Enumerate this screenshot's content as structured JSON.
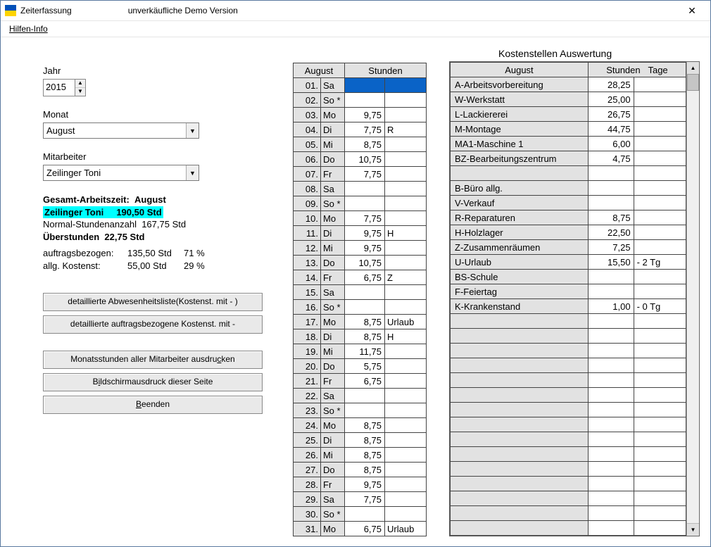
{
  "window": {
    "title": "Zeiterfassung",
    "subtitle": "unverkäufliche Demo Version"
  },
  "menu": {
    "hilfen": "Hilfen-Info"
  },
  "left": {
    "year_label": "Jahr",
    "year_value": "2015",
    "month_label": "Monat",
    "month_value": "August",
    "employee_label": "Mitarbeiter",
    "employee_value": "Zeilinger Toni",
    "summary": {
      "header_prefix": "Gesamt-Arbeitszeit:",
      "header_month": "August",
      "hi_name": "Zeilinger Toni",
      "hi_hours": "190,50 Std",
      "normal_label": "Normal-Stundenanzahl",
      "normal_value": "167,75 Std",
      "over_label": "Überstunden",
      "over_value": "22,75 Std",
      "auftrag_label": "auftragsbezogen:",
      "auftrag_value": "135,50 Std",
      "auftrag_pct": "71 %",
      "allg_label": "allg. Kostenst:",
      "allg_value": "55,00 Std",
      "allg_pct": "29 %"
    },
    "buttons": {
      "b1": "detaillierte Abwesenheitsliste(Kostenst. mit - )",
      "b2": "detaillierte auftragsbezogene Kostenst. mit -",
      "b3_pre": "Monatsstunden aller Mitarbeiter ausdru",
      "b3_u": "c",
      "b3_post": "ken",
      "b4_pre": "B",
      "b4_u": "i",
      "b4_post": "ldschirmausdruck dieser Seite",
      "b5_u": "B",
      "b5_post": "eenden"
    }
  },
  "mid": {
    "h1": "August",
    "h2": "Stunden",
    "rows": [
      {
        "d": "01.",
        "wd": "Sa",
        "h": "",
        "n": "",
        "sel": true
      },
      {
        "d": "02.",
        "wd": "So *",
        "h": "",
        "n": ""
      },
      {
        "d": "03.",
        "wd": "Mo",
        "h": "9,75",
        "n": ""
      },
      {
        "d": "04.",
        "wd": "Di",
        "h": "7,75",
        "n": "R"
      },
      {
        "d": "05.",
        "wd": "Mi",
        "h": "8,75",
        "n": ""
      },
      {
        "d": "06.",
        "wd": "Do",
        "h": "10,75",
        "n": ""
      },
      {
        "d": "07.",
        "wd": "Fr",
        "h": "7,75",
        "n": ""
      },
      {
        "d": "08.",
        "wd": "Sa",
        "h": "",
        "n": ""
      },
      {
        "d": "09.",
        "wd": "So *",
        "h": "",
        "n": ""
      },
      {
        "d": "10.",
        "wd": "Mo",
        "h": "7,75",
        "n": ""
      },
      {
        "d": "11.",
        "wd": "Di",
        "h": "9,75",
        "n": "H"
      },
      {
        "d": "12.",
        "wd": "Mi",
        "h": "9,75",
        "n": ""
      },
      {
        "d": "13.",
        "wd": "Do",
        "h": "10,75",
        "n": ""
      },
      {
        "d": "14.",
        "wd": "Fr",
        "h": "6,75",
        "n": "Z"
      },
      {
        "d": "15.",
        "wd": "Sa",
        "h": "",
        "n": ""
      },
      {
        "d": "16.",
        "wd": "So *",
        "h": "",
        "n": ""
      },
      {
        "d": "17.",
        "wd": "Mo",
        "h": "8,75",
        "n": "Urlaub"
      },
      {
        "d": "18.",
        "wd": "Di",
        "h": "8,75",
        "n": "H"
      },
      {
        "d": "19.",
        "wd": "Mi",
        "h": "11,75",
        "n": ""
      },
      {
        "d": "20.",
        "wd": "Do",
        "h": "5,75",
        "n": ""
      },
      {
        "d": "21.",
        "wd": "Fr",
        "h": "6,75",
        "n": ""
      },
      {
        "d": "22.",
        "wd": "Sa",
        "h": "",
        "n": ""
      },
      {
        "d": "23.",
        "wd": "So *",
        "h": "",
        "n": ""
      },
      {
        "d": "24.",
        "wd": "Mo",
        "h": "8,75",
        "n": ""
      },
      {
        "d": "25.",
        "wd": "Di",
        "h": "8,75",
        "n": ""
      },
      {
        "d": "26.",
        "wd": "Mi",
        "h": "8,75",
        "n": ""
      },
      {
        "d": "27.",
        "wd": "Do",
        "h": "8,75",
        "n": ""
      },
      {
        "d": "28.",
        "wd": "Fr",
        "h": "9,75",
        "n": ""
      },
      {
        "d": "29.",
        "wd": "Sa",
        "h": "7,75",
        "n": ""
      },
      {
        "d": "30.",
        "wd": "So *",
        "h": "",
        "n": ""
      },
      {
        "d": "31.",
        "wd": "Mo",
        "h": "6,75",
        "n": "Urlaub"
      }
    ]
  },
  "right": {
    "title": "Kostenstellen Auswertung",
    "h1": "August",
    "h2": "Stunden",
    "h3": "Tage",
    "rows": [
      {
        "name": "A-Arbeitsvorbereitung",
        "h": "28,25",
        "d": ""
      },
      {
        "name": "W-Werkstatt",
        "h": "25,00",
        "d": ""
      },
      {
        "name": "L-Lackiererei",
        "h": "26,75",
        "d": ""
      },
      {
        "name": "M-Montage",
        "h": "44,75",
        "d": ""
      },
      {
        "name": "MA1-Maschine 1",
        "h": "6,00",
        "d": ""
      },
      {
        "name": "BZ-Bearbeitungszentrum",
        "h": "4,75",
        "d": ""
      },
      {
        "name": "",
        "h": "",
        "d": "",
        "blank": true
      },
      {
        "name": "B-Büro allg.",
        "h": "",
        "d": ""
      },
      {
        "name": "V-Verkauf",
        "h": "",
        "d": ""
      },
      {
        "name": "R-Reparaturen",
        "h": "8,75",
        "d": ""
      },
      {
        "name": "H-Holzlager",
        "h": "22,50",
        "d": ""
      },
      {
        "name": "Z-Zusammenräumen",
        "h": "7,25",
        "d": ""
      },
      {
        "name": "U-Urlaub",
        "h": "15,50",
        "d": "-  2 Tg"
      },
      {
        "name": "BS-Schule",
        "h": "",
        "d": ""
      },
      {
        "name": "F-Feiertag",
        "h": "",
        "d": ""
      },
      {
        "name": "K-Krankenstand",
        "h": "1,00",
        "d": "-  0 Tg"
      }
    ],
    "blank_rows": 15
  }
}
